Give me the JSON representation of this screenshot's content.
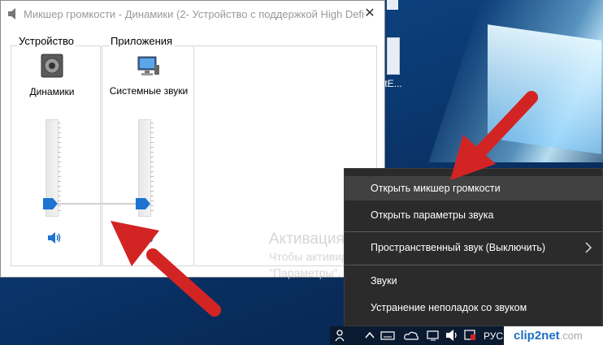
{
  "window": {
    "title": "Микшер громкости - Динамики (2- Устройство с поддержкой High Defin",
    "close_glyph": "✕"
  },
  "mixer": {
    "device_section_label": "Устройство",
    "apps_section_label": "Приложения",
    "channels": [
      {
        "name": "Динамики",
        "icon": "speaker-device-icon",
        "volume_fraction": 0.0,
        "muted": false
      },
      {
        "name": "Системные звуки",
        "icon": "system-sounds-icon",
        "volume_fraction": 0.0,
        "muted": false
      }
    ]
  },
  "desktop": {
    "icon_label": "ftE..."
  },
  "watermark": {
    "title": "Активация Windows",
    "line1": "Чтобы активировать Windows, перейдите в раздел",
    "line2": "\"Параметры\"."
  },
  "context_menu": {
    "items": [
      {
        "label": "Открыть микшер громкости",
        "highlighted": true
      },
      {
        "label": "Открыть параметры звука",
        "highlighted": false
      },
      {
        "label": "Пространственный звук (Выключить)",
        "highlighted": false,
        "has_submenu": true
      },
      {
        "label": "Звуки",
        "highlighted": false
      },
      {
        "label": "Устранение неполадок со звуком",
        "highlighted": false
      }
    ]
  },
  "taskbar": {
    "language": "РУС",
    "tray_icons": [
      "people-icon",
      "chevron-up-icon",
      "keyboard-icon",
      "onedrive-icon",
      "network-icon",
      "volume-icon",
      "action-center-icon"
    ]
  },
  "branding": {
    "clip2net_main": "clip2net",
    "clip2net_domain": ".com"
  },
  "colors": {
    "accent": "#1e74d0",
    "arrow_red": "#d32424",
    "menu_bg": "#2b2b2b",
    "menu_highlight": "#414141"
  }
}
